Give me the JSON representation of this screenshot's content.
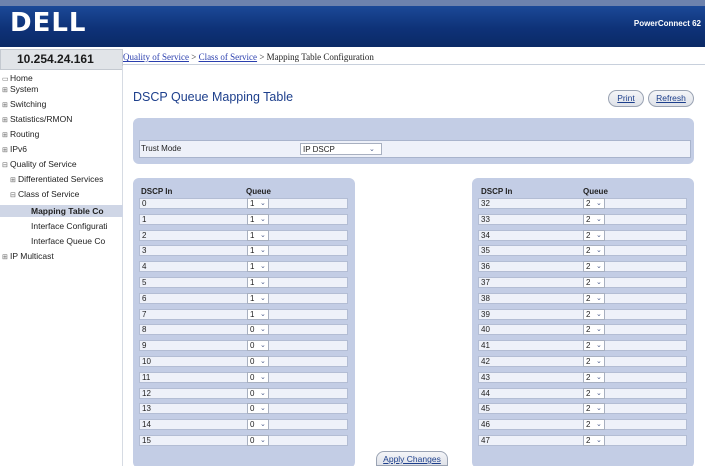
{
  "header": {
    "logo": "DELL",
    "product": "PowerConnect 62"
  },
  "ip_address": "10.254.24.161",
  "breadcrumb": {
    "item1": "Quality of Service",
    "sep1": " > ",
    "item2": "Class of Service",
    "sep2": " > ",
    "current": "Mapping Table Configuration"
  },
  "nav": {
    "home": "Home",
    "system": "System",
    "switching": "Switching",
    "statistics": "Statistics/RMON",
    "routing": "Routing",
    "ipv6": "IPv6",
    "qos": "Quality of Service",
    "diffserv": "Differentiated Services",
    "cos": "Class of Service",
    "mapping": "Mapping Table Co",
    "interface_cfg": "Interface Configurati",
    "interface_queue": "Interface Queue Co",
    "multicast": "IP Multicast"
  },
  "page": {
    "title": "DSCP Queue Mapping Table",
    "print_label": "Print",
    "refresh_label": "Refresh",
    "apply_label": "Apply Changes"
  },
  "trust": {
    "label": "Trust Mode",
    "value": "IP DSCP"
  },
  "table": {
    "col_dscp": "DSCP In",
    "col_queue": "Queue",
    "left_rows": [
      {
        "dscp": "0",
        "queue": "1"
      },
      {
        "dscp": "1",
        "queue": "1"
      },
      {
        "dscp": "2",
        "queue": "1"
      },
      {
        "dscp": "3",
        "queue": "1"
      },
      {
        "dscp": "4",
        "queue": "1"
      },
      {
        "dscp": "5",
        "queue": "1"
      },
      {
        "dscp": "6",
        "queue": "1"
      },
      {
        "dscp": "7",
        "queue": "1"
      },
      {
        "dscp": "8",
        "queue": "0"
      },
      {
        "dscp": "9",
        "queue": "0"
      },
      {
        "dscp": "10",
        "queue": "0"
      },
      {
        "dscp": "11",
        "queue": "0"
      },
      {
        "dscp": "12",
        "queue": "0"
      },
      {
        "dscp": "13",
        "queue": "0"
      },
      {
        "dscp": "14",
        "queue": "0"
      },
      {
        "dscp": "15",
        "queue": "0"
      }
    ],
    "right_rows": [
      {
        "dscp": "32",
        "queue": "2"
      },
      {
        "dscp": "33",
        "queue": "2"
      },
      {
        "dscp": "34",
        "queue": "2"
      },
      {
        "dscp": "35",
        "queue": "2"
      },
      {
        "dscp": "36",
        "queue": "2"
      },
      {
        "dscp": "37",
        "queue": "2"
      },
      {
        "dscp": "38",
        "queue": "2"
      },
      {
        "dscp": "39",
        "queue": "2"
      },
      {
        "dscp": "40",
        "queue": "2"
      },
      {
        "dscp": "41",
        "queue": "2"
      },
      {
        "dscp": "42",
        "queue": "2"
      },
      {
        "dscp": "43",
        "queue": "2"
      },
      {
        "dscp": "44",
        "queue": "2"
      },
      {
        "dscp": "45",
        "queue": "2"
      },
      {
        "dscp": "46",
        "queue": "2"
      },
      {
        "dscp": "47",
        "queue": "2"
      }
    ]
  }
}
